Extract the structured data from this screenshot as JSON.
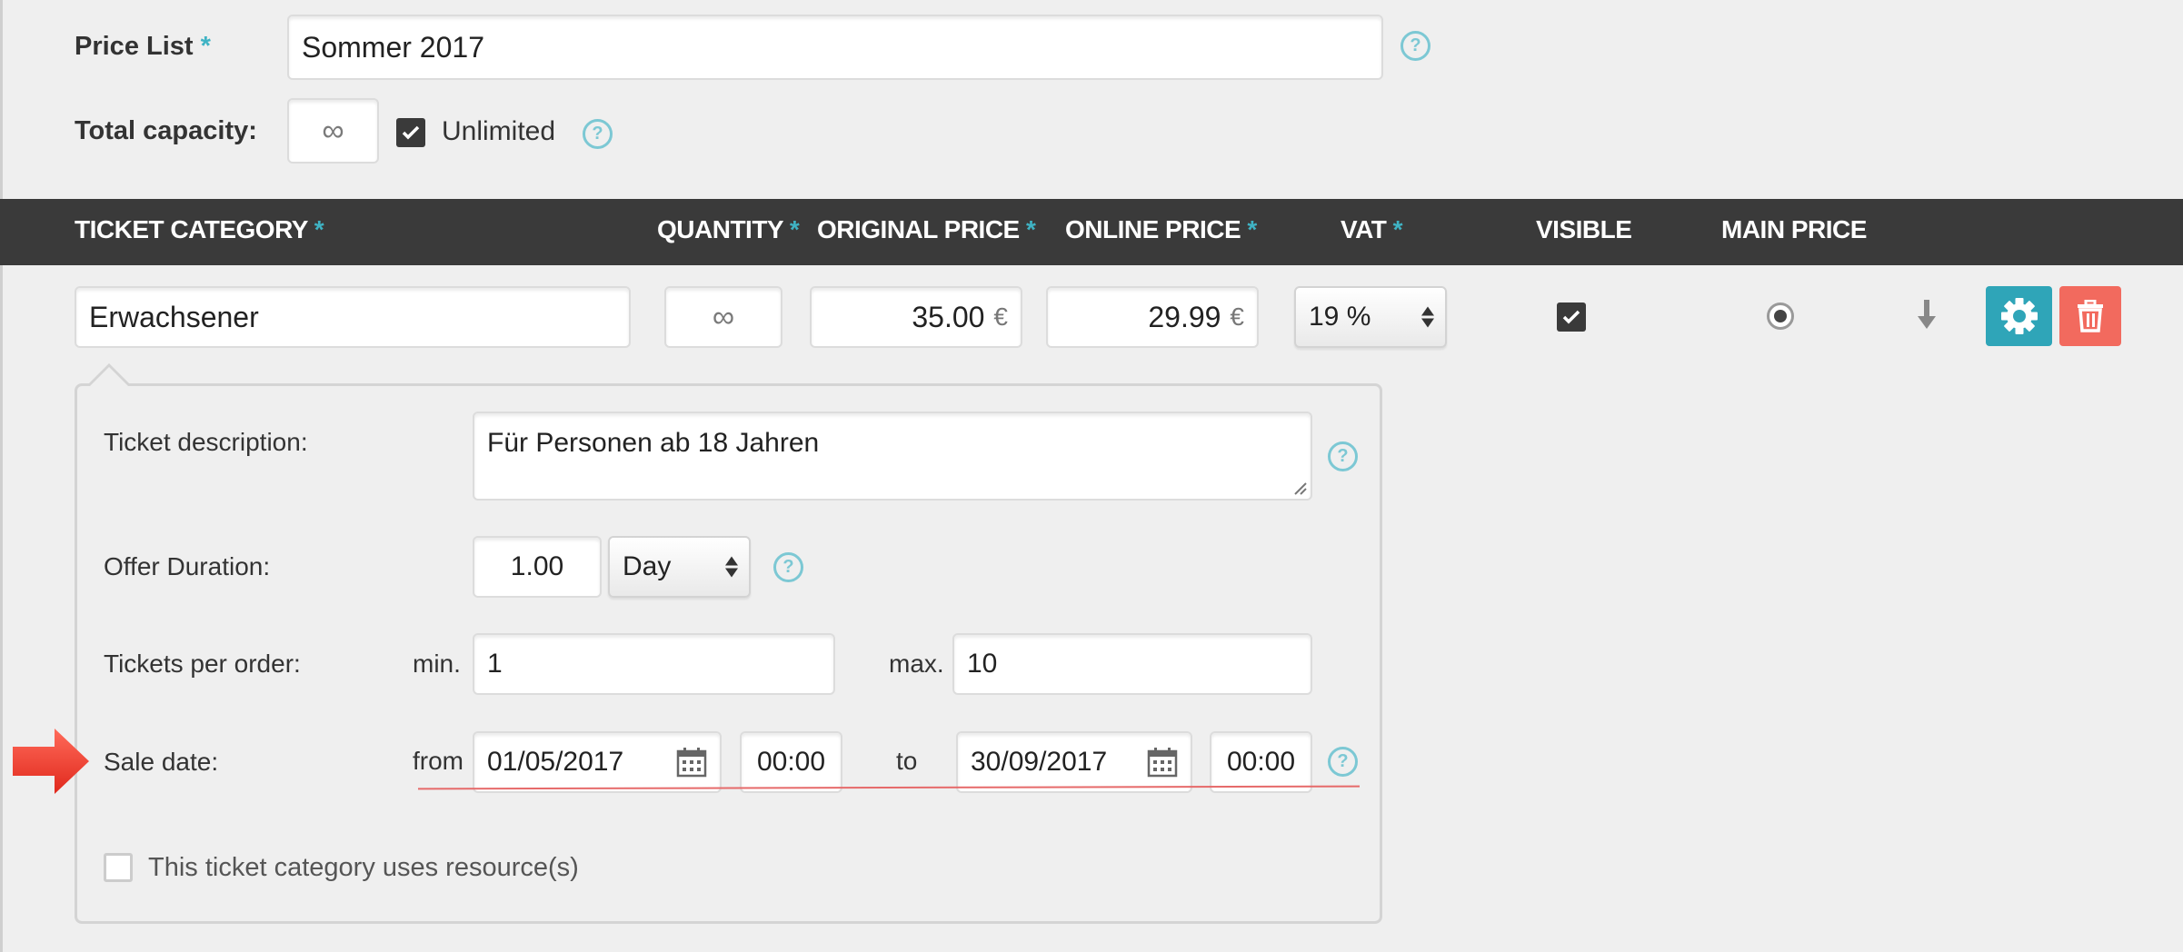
{
  "form": {
    "price_list_label": "Price List",
    "required_mark": "*",
    "price_list_value": "Sommer 2017",
    "total_capacity_label": "Total capacity:",
    "total_capacity_value": "∞",
    "unlimited_label": "Unlimited",
    "unlimited_checked": true,
    "help_glyph": "?"
  },
  "table": {
    "headers": {
      "ticket_category": "TICKET CATEGORY",
      "quantity": "QUANTITY",
      "original_price": "ORIGINAL PRICE",
      "online_price": "ONLINE PRICE",
      "vat": "VAT",
      "visible": "VISIBLE",
      "main_price": "MAIN PRICE"
    },
    "row": {
      "category": "Erwachsener",
      "quantity": "∞",
      "original_price": "35.00",
      "online_price": "29.99",
      "currency": "€",
      "vat": "19 %",
      "visible_checked": true,
      "main_price_selected": true
    },
    "icons": {
      "move_down": "arrow-down-icon",
      "settings": "gear-icon",
      "delete": "trash-icon"
    },
    "colors": {
      "settings_button": "#2fa5b8",
      "delete_button": "#f26a5e",
      "header_bar": "#3a3a3a",
      "required_star": "#3fb3c4"
    }
  },
  "details": {
    "description_label": "Ticket description:",
    "description_value": "Für Personen ab 18 Jahren",
    "offer_duration_label": "Offer Duration:",
    "offer_duration_value": "1.00",
    "offer_duration_unit": "Day",
    "tickets_per_order_label": "Tickets per order:",
    "min_label": "min.",
    "min_value": "1",
    "max_label": "max.",
    "max_value": "10",
    "sale_date_label": "Sale date:",
    "from_label": "from",
    "from_date": "01/05/2017",
    "from_time": "00:00",
    "to_label": "to",
    "to_date": "30/09/2017",
    "to_time": "00:00",
    "resources_label": "This ticket category uses resource(s)",
    "resources_checked": false
  }
}
